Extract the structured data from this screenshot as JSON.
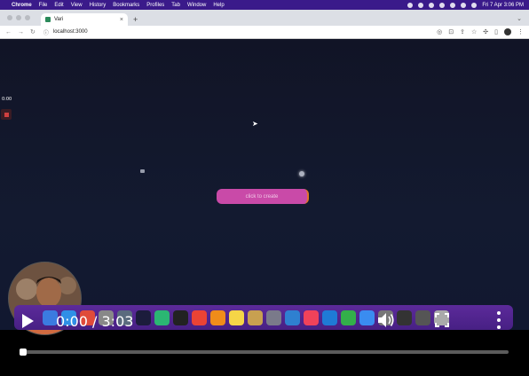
{
  "menubar": {
    "app": "Chrome",
    "items": [
      "File",
      "Edit",
      "View",
      "History",
      "Bookmarks",
      "Profiles",
      "Tab",
      "Window",
      "Help"
    ],
    "clock": "Fri 7 Apr  3:06 PM",
    "color": "#3a1a8a"
  },
  "browser": {
    "tab_title": "Vari",
    "url": "localhost:3000"
  },
  "page": {
    "timer": "0:00",
    "create_button_label": "click to create",
    "create_button_color": "#c94aa8"
  },
  "video": {
    "current_time": "0:00",
    "separator": " / ",
    "duration": "3:03",
    "progress": 0.0
  },
  "dock": {
    "background": "#472084",
    "apps": [
      {
        "name": "finder-icon",
        "color": "#3b7be0"
      },
      {
        "name": "safari-icon",
        "color": "#2f8fe6"
      },
      {
        "name": "chrome-icon",
        "color": "#e04b3a"
      },
      {
        "name": "launchpad-icon",
        "color": "#888888"
      },
      {
        "name": "system-icon",
        "color": "#5a6b7e"
      },
      {
        "name": "intellij-icon",
        "color": "#1c1c3c"
      },
      {
        "name": "pycharm-icon",
        "color": "#2bb673"
      },
      {
        "name": "terminal-icon",
        "color": "#222222"
      },
      {
        "name": "chrome-alt-icon",
        "color": "#ea4335"
      },
      {
        "name": "vlc-icon",
        "color": "#f08c1a"
      },
      {
        "name": "notes-icon",
        "color": "#f5d547"
      },
      {
        "name": "tools-icon",
        "color": "#c8a050"
      },
      {
        "name": "settings-icon",
        "color": "#7a7a8a"
      },
      {
        "name": "vscode-icon",
        "color": "#2f80d0"
      },
      {
        "name": "music-icon",
        "color": "#f0425a"
      },
      {
        "name": "xcode-icon",
        "color": "#1f7ad6"
      },
      {
        "name": "numbers-icon",
        "color": "#33b04a"
      },
      {
        "name": "mail-icon",
        "color": "#3a8cf0"
      },
      {
        "name": "preview-icon",
        "color": "#777777"
      },
      {
        "name": "monitor-icon",
        "color": "#333333"
      },
      {
        "name": "folder-icon",
        "color": "#555555"
      },
      {
        "name": "trash-icon",
        "color": "#aaaaaa"
      }
    ]
  }
}
